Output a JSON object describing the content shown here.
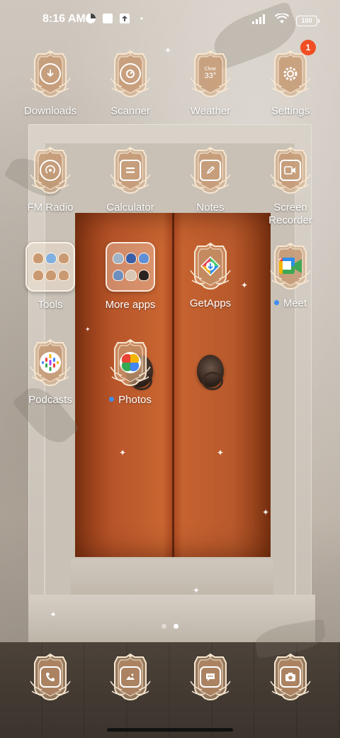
{
  "status_bar": {
    "time": "8:16 AM",
    "battery": "100",
    "icons_left": [
      "data-saver-icon",
      "square-icon",
      "upload-icon",
      "dot-icon"
    ],
    "icons_right": [
      "signal-icon",
      "wifi-icon",
      "battery-icon"
    ]
  },
  "apps": [
    {
      "label": "Downloads",
      "icon": "download-icon"
    },
    {
      "label": "Scanner",
      "icon": "scanner-icon"
    },
    {
      "label": "Weather",
      "icon": "weather-icon",
      "weather_text": "Clear",
      "weather_temp": "33°"
    },
    {
      "label": "Settings",
      "icon": "gear-icon",
      "badge": "1"
    },
    {
      "label": "FM Radio",
      "icon": "radio-icon"
    },
    {
      "label": "Calculator",
      "icon": "calculator-icon"
    },
    {
      "label": "Notes",
      "icon": "notes-icon"
    },
    {
      "label": "Screen\nRecorder",
      "icon": "screen-recorder-icon"
    },
    {
      "label": "Tools",
      "icon": "folder-icon"
    },
    {
      "label": "More apps",
      "icon": "folder-icon"
    },
    {
      "label": "GetApps",
      "icon": "getapps-icon"
    },
    {
      "label": "Meet",
      "icon": "meet-icon",
      "new_dot": true
    },
    {
      "label": "Podcasts",
      "icon": "podcasts-icon"
    },
    {
      "label": "Photos",
      "icon": "photos-icon",
      "new_dot": true
    }
  ],
  "dock": [
    {
      "icon": "phone-icon"
    },
    {
      "icon": "gallery-icon"
    },
    {
      "icon": "messages-icon"
    },
    {
      "icon": "camera-icon"
    }
  ],
  "page_indicator": {
    "pages": 2,
    "current": 2
  },
  "colors": {
    "badge": "#f04e23",
    "new_dot": "#3d8ef2",
    "icon_frame": "#f3e3cc"
  }
}
